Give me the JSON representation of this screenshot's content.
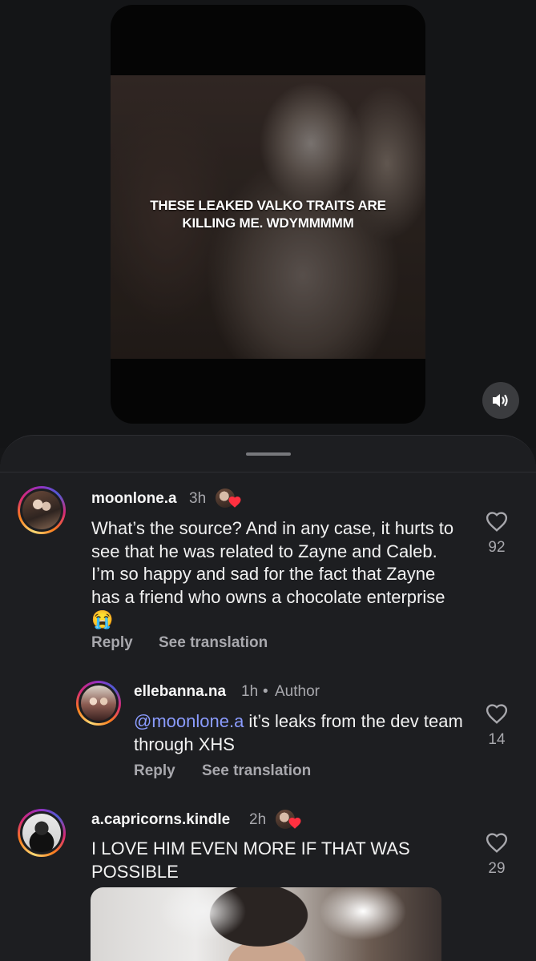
{
  "video": {
    "caption_line1": "THESE LEAKED VALKO TRAITS ARE",
    "caption_line2": "KILLING ME. WDYMMMMM",
    "sound_icon": "speaker-volume-icon"
  },
  "comments": [
    {
      "username": "moonlone.a",
      "time": "3h",
      "liked_by_creator": true,
      "text": "What’s the source? And in any case, it hurts to see that he was related to Zayne and Caleb. I’m so happy and sad for the fact that Zayne has a friend who owns a chocolate enterprise 😭",
      "reply_label": "Reply",
      "translate_label": "See translation",
      "likes": "92"
    },
    {
      "username": "ellebanna.na",
      "time": "1h",
      "separator": "•",
      "author_label": "Author",
      "mention": "@moonlone.a",
      "text": " it’s leaks from the dev team through XHS",
      "reply_label": "Reply",
      "translate_label": "See translation",
      "likes": "14"
    },
    {
      "username": "a.capricorns.kindle",
      "time": "2h",
      "liked_by_creator": true,
      "text": "I LOVE HIM EVEN MORE IF THAT WAS POSSIBLE",
      "likes": "29"
    }
  ],
  "colors": {
    "background": "#151618",
    "sheet": "#1d1e21",
    "mention": "#8b9cff",
    "secondary_text": "#a8a8ad",
    "heart_red": "#ff3040"
  }
}
